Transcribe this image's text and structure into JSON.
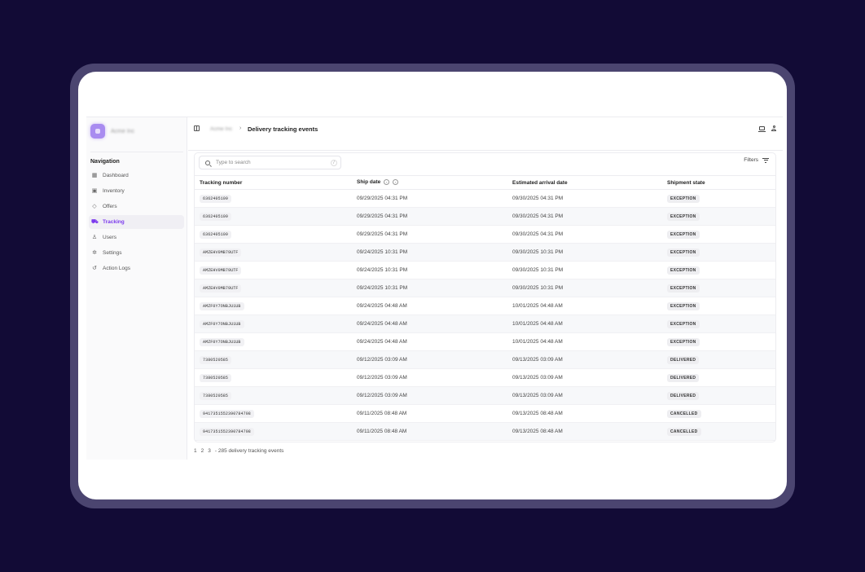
{
  "sidebar": {
    "brand_name": "Acme Inc",
    "nav_title": "Navigation",
    "items": [
      {
        "label": "Dashboard",
        "icon": "grid-icon"
      },
      {
        "label": "Inventory",
        "icon": "box-icon"
      },
      {
        "label": "Offers",
        "icon": "tag-icon"
      },
      {
        "label": "Tracking",
        "icon": "truck-icon",
        "active": true
      },
      {
        "label": "Users",
        "icon": "user-icon"
      },
      {
        "label": "Settings",
        "icon": "gear-icon"
      },
      {
        "label": "Action Logs",
        "icon": "history-icon"
      }
    ]
  },
  "header": {
    "breadcrumb_parent": "Acme Inc",
    "title": "Delivery tracking events"
  },
  "search": {
    "placeholder": "Type to search",
    "shortcut": "/"
  },
  "filters_label": "Filters",
  "table": {
    "columns": [
      "Tracking number",
      "Ship date",
      "Estimated arrival date",
      "Shipment state"
    ],
    "rows": [
      [
        "6362405109",
        "09/29/2025 04:31 PM",
        "09/30/2025 04:31 PM",
        "EXCEPTION"
      ],
      [
        "6362405109",
        "09/29/2025 04:31 PM",
        "09/30/2025 04:31 PM",
        "EXCEPTION"
      ],
      [
        "6362405109",
        "09/29/2025 04:31 PM",
        "09/30/2025 04:31 PM",
        "EXCEPTION"
      ],
      [
        "AMZEHV0MB79UTF",
        "09/24/2025 10:31 PM",
        "09/30/2025 10:31 PM",
        "EXCEPTION"
      ],
      [
        "AMZEHV0MB79UTF",
        "09/24/2025 10:31 PM",
        "09/30/2025 10:31 PM",
        "EXCEPTION"
      ],
      [
        "AMZEHV0MB79UTF",
        "09/24/2025 10:31 PM",
        "09/30/2025 10:31 PM",
        "EXCEPTION"
      ],
      [
        "AMZF0Y7ONBJU1UB",
        "09/24/2025 04:48 AM",
        "10/01/2025 04:48 AM",
        "EXCEPTION"
      ],
      [
        "AMZF0Y7ONBJU1UB",
        "09/24/2025 04:48 AM",
        "10/01/2025 04:48 AM",
        "EXCEPTION"
      ],
      [
        "AMZF0Y7ONBJU1UB",
        "09/24/2025 04:48 AM",
        "10/01/2025 04:48 AM",
        "EXCEPTION"
      ],
      [
        "7380520585",
        "09/12/2025 03:09 AM",
        "09/13/2025 03:09 AM",
        "DELIVERED"
      ],
      [
        "7380520585",
        "09/12/2025 03:09 AM",
        "09/13/2025 03:09 AM",
        "DELIVERED"
      ],
      [
        "7380520585",
        "09/12/2025 03:09 AM",
        "09/13/2025 03:09 AM",
        "DELIVERED"
      ],
      [
        "9417351552390784798",
        "09/11/2025 08:48 AM",
        "09/13/2025 08:48 AM",
        "CANCELLED"
      ],
      [
        "9417351552390784798",
        "09/11/2025 08:48 AM",
        "09/13/2025 08:48 AM",
        "CANCELLED"
      ]
    ]
  },
  "pagination": {
    "pages": [
      "1",
      "2",
      "3"
    ],
    "summary": "- 285 delivery tracking events"
  },
  "colors": {
    "background": "#120b36",
    "frame": "#4b4570",
    "accent": "#7c3aed"
  }
}
